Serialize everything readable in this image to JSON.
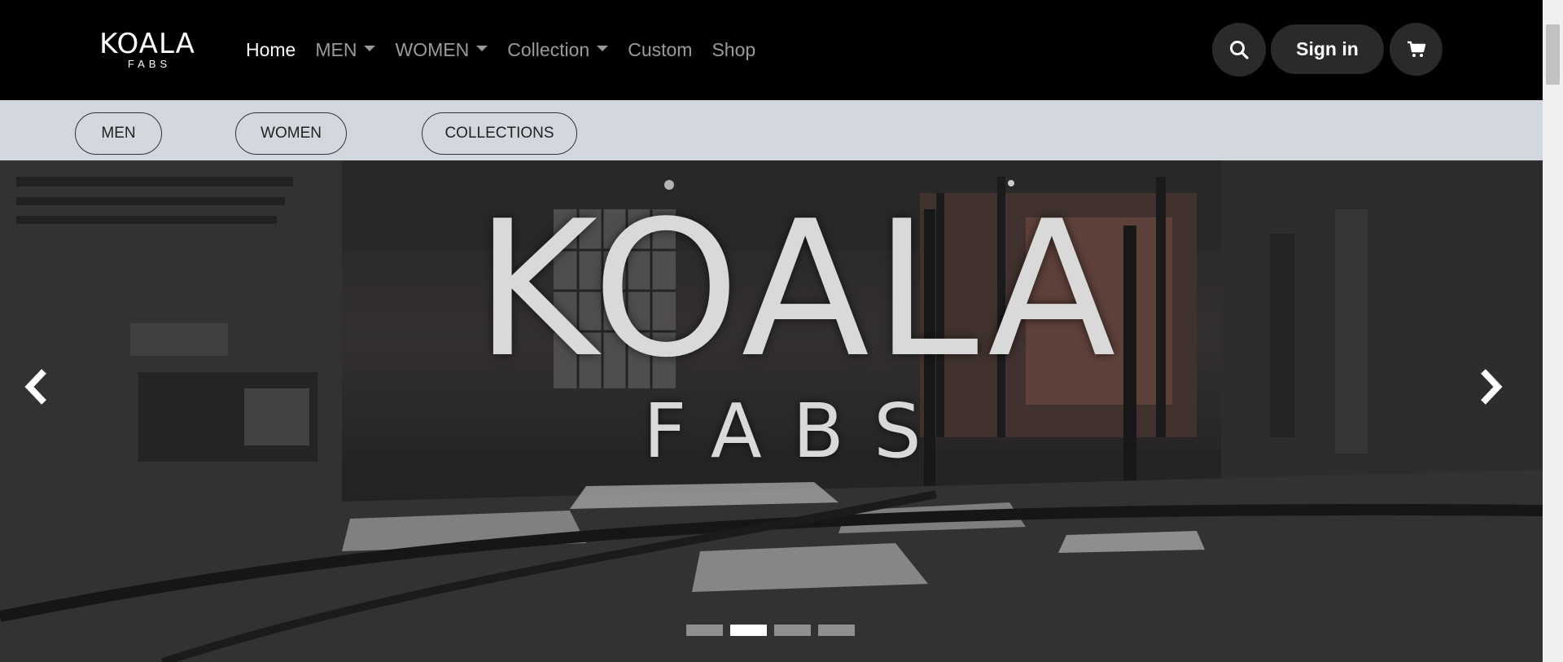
{
  "brand": {
    "main": "KOALA",
    "sub": "FABS"
  },
  "nav": {
    "items": [
      {
        "label": "Home",
        "active": true,
        "dropdown": false
      },
      {
        "label": "MEN",
        "active": false,
        "dropdown": true
      },
      {
        "label": "WOMEN",
        "active": false,
        "dropdown": true
      },
      {
        "label": "Collection",
        "active": false,
        "dropdown": true
      },
      {
        "label": "Custom",
        "active": false,
        "dropdown": false
      },
      {
        "label": "Shop",
        "active": false,
        "dropdown": false
      }
    ],
    "search_icon": "search-icon",
    "signin_label": "Sign in",
    "cart_icon": "cart-icon"
  },
  "subnav": {
    "men_label": "MEN",
    "women_label": "WOMEN",
    "collections_label": "COLLECTIONS"
  },
  "hero": {
    "title": "KOALA",
    "subtitle": "FABS",
    "prev_icon": "chevron-left-icon",
    "next_icon": "chevron-right-icon",
    "slide_count": 4,
    "active_slide": 2
  },
  "colors": {
    "navbar_bg": "#000000",
    "subnav_bg": "#d3d7de",
    "nav_active": "#ffffff",
    "nav_inactive": "#9a9a9a",
    "button_bg": "#2a2a2a"
  }
}
